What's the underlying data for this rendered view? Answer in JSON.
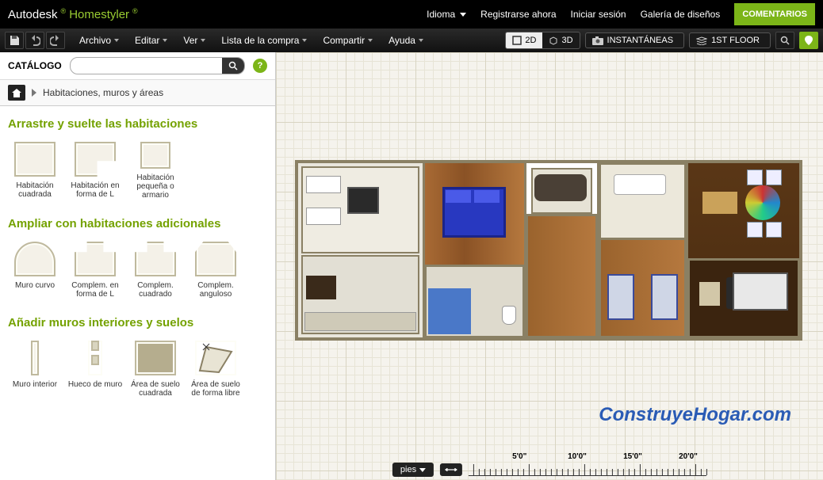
{
  "topbar": {
    "brand_left": "Autodesk",
    "brand_right": "Homestyler",
    "idioma": "Idioma",
    "register": "Registrarse ahora",
    "login": "Iniciar sesión",
    "gallery": "Galería de diseños",
    "comments": "COMENTARIOS"
  },
  "menubar": {
    "items": [
      "Archivo",
      "Editar",
      "Ver",
      "Lista de la compra",
      "Compartir",
      "Ayuda"
    ],
    "mode_2d": "2D",
    "mode_3d": "3D",
    "snapshots": "INSTANTÁNEAS",
    "floor": "1ST FLOOR"
  },
  "catalog": {
    "label": "CATÁLOGO",
    "search_placeholder": "",
    "breadcrumb": "Habitaciones, muros y áreas"
  },
  "sections": {
    "drag": {
      "title": "Arrastre y suelte las habitaciones",
      "tiles": [
        "Habitación cuadrada",
        "Habitación en forma de L",
        "Habitación pequeña o armario"
      ]
    },
    "extend": {
      "title": "Ampliar con habitaciones adicionales",
      "tiles": [
        "Muro curvo",
        "Complem. en forma de L",
        "Complem. cuadrado",
        "Complem. anguloso"
      ]
    },
    "walls": {
      "title": "Añadir muros interiores y suelos",
      "tiles": [
        "Muro interior",
        "Hueco de muro",
        "Área de suelo cuadrada",
        "Área de suelo de forma libre"
      ]
    }
  },
  "canvas": {
    "watermark": "ConstruyeHogar.com",
    "unit_btn": "pies",
    "ruler_labels": [
      "5'0\"",
      "10'0\"",
      "15'0\"",
      "20'0\""
    ]
  }
}
